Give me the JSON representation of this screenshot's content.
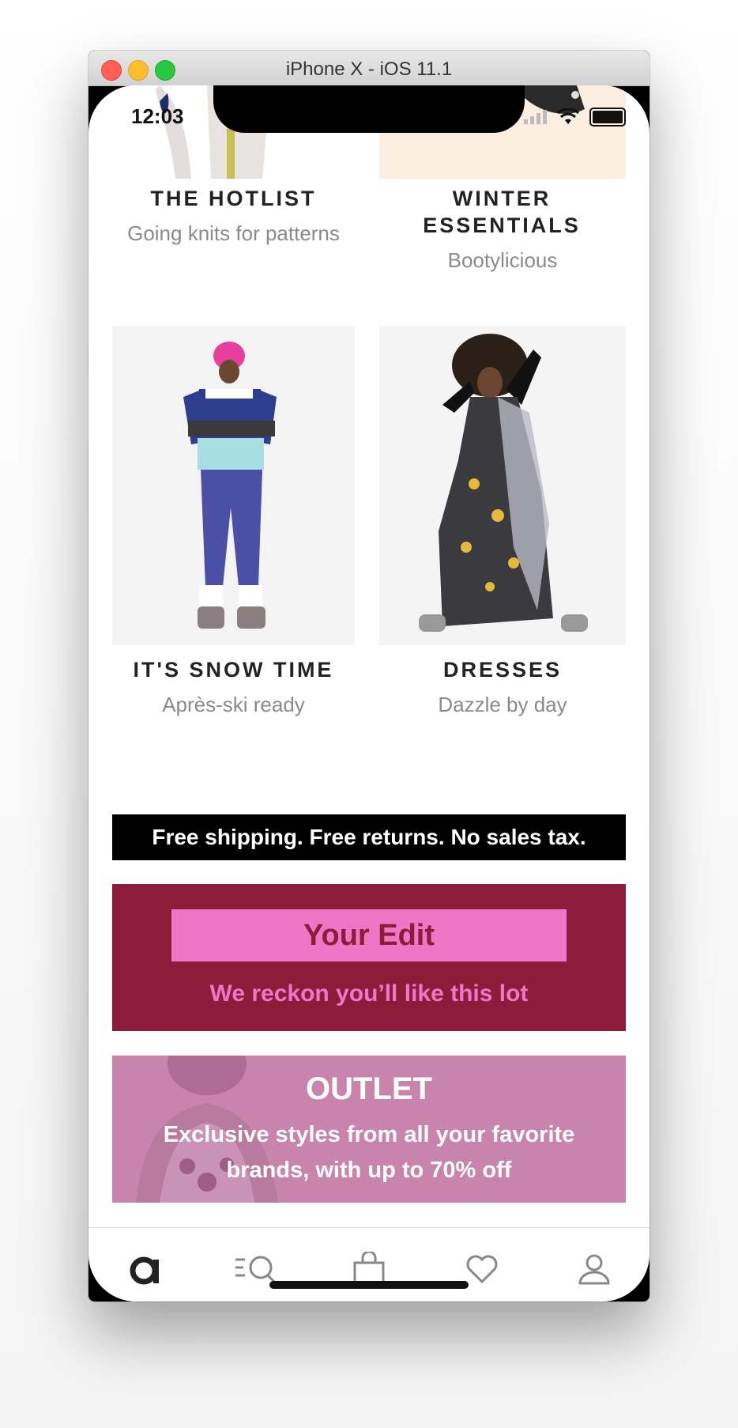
{
  "window": {
    "title": "iPhone X - iOS 11.1"
  },
  "status_bar": {
    "time": "12:03"
  },
  "tiles": [
    {
      "title": "THE HOTLIST",
      "subtitle": "Going knits for patterns"
    },
    {
      "title": "WINTER ESSENTIALS",
      "subtitle": "Bootylicious"
    },
    {
      "title": "IT'S SNOW TIME",
      "subtitle": "Après-ski ready"
    },
    {
      "title": "DRESSES",
      "subtitle": "Dazzle by day"
    }
  ],
  "shipping_banner": {
    "text": "Free shipping. Free returns. No sales tax."
  },
  "your_edit": {
    "title": "Your Edit",
    "subtitle": "We reckon you’ll like this lot",
    "bg_color": "#8c1c3a",
    "accent_color": "#ef76c7"
  },
  "outlet": {
    "title": "OUTLET",
    "subtitle": "Exclusive styles from all your favorite brands, with up to 70% off",
    "bg_color": "#c984ae"
  },
  "tab_bar": {
    "items": [
      {
        "label": "home",
        "icon": "asos-a-icon"
      },
      {
        "label": "search",
        "icon": "search-icon"
      },
      {
        "label": "bag",
        "icon": "bag-icon"
      },
      {
        "label": "saved",
        "icon": "heart-icon"
      },
      {
        "label": "account",
        "icon": "profile-icon"
      }
    ]
  }
}
